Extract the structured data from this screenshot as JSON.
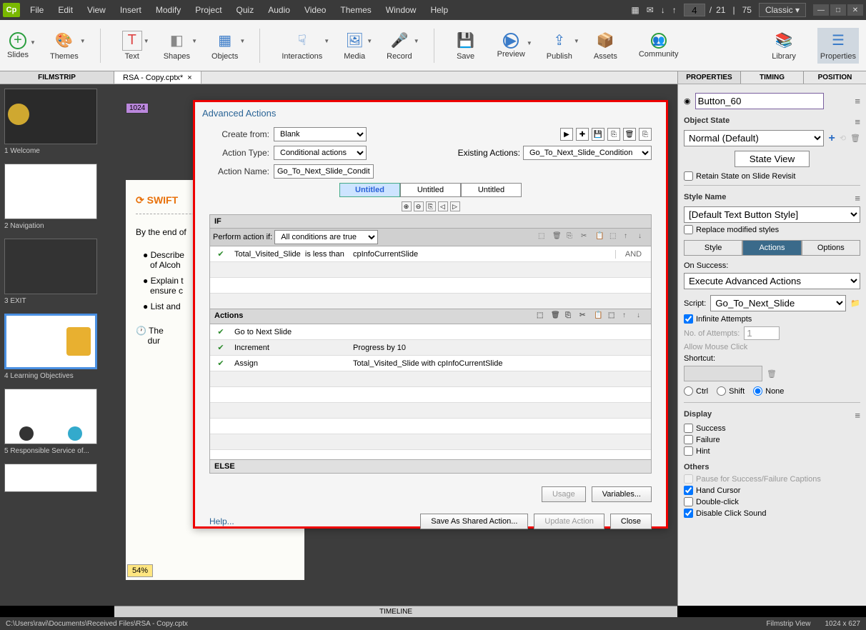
{
  "app_icon": "Cp",
  "menus": [
    "File",
    "Edit",
    "View",
    "Insert",
    "Modify",
    "Project",
    "Quiz",
    "Audio",
    "Video",
    "Themes",
    "Window",
    "Help"
  ],
  "page_current": "4",
  "page_total": "21",
  "zoom_pct": "75",
  "workspace": "Classic",
  "ribbon": {
    "slides": "Slides",
    "themes": "Themes",
    "text": "Text",
    "shapes": "Shapes",
    "objects": "Objects",
    "interactions": "Interactions",
    "media": "Media",
    "record": "Record",
    "save": "Save",
    "preview": "Preview",
    "publish": "Publish",
    "assets": "Assets",
    "community": "Community",
    "library": "Library",
    "properties": "Properties"
  },
  "filmstrip_label": "FILMSTRIP",
  "doc_tab": "RSA - Copy.cptx*",
  "prop_tabs": {
    "properties": "PROPERTIES",
    "timing": "TIMING",
    "position": "POSITION"
  },
  "thumbs": [
    {
      "label": "1 Welcome"
    },
    {
      "label": "2 Navigation"
    },
    {
      "label": "3 EXIT"
    },
    {
      "label": "4 Learning Objectives"
    },
    {
      "label": "5 Responsible Service of..."
    },
    {
      "label": ""
    }
  ],
  "ruler_value": "1024",
  "canvas_zoom": "54%",
  "timeline_label": "TIMELINE",
  "dialog": {
    "title": "Advanced Actions",
    "create_from_label": "Create from:",
    "create_from": "Blank",
    "action_type_label": "Action Type:",
    "action_type": "Conditional actions",
    "action_name_label": "Action Name:",
    "action_name": "Go_To_Next_Slide_Condition",
    "existing_label": "Existing Actions:",
    "existing": "Go_To_Next_Slide_Condition",
    "tab_label": "Untitled",
    "if_label": "IF",
    "perform_label": "Perform action if:",
    "perform_condition": "All conditions are true",
    "cond_var": "Total_Visited_Slide",
    "cond_op": "is less than",
    "cond_val": "cpInfoCurrentSlide",
    "cond_and": "AND",
    "actions_label": "Actions",
    "action_rows": [
      {
        "a": "Go to Next Slide",
        "b": ""
      },
      {
        "a": "Increment",
        "b": "Progress   by   10"
      },
      {
        "a": "Assign",
        "b": "Total_Visited_Slide   with   cpInfoCurrentSlide"
      }
    ],
    "else_label": "ELSE",
    "usage_btn": "Usage",
    "variables_btn": "Variables...",
    "help": "Help...",
    "save_shared": "Save As Shared Action...",
    "update": "Update Action",
    "close": "Close"
  },
  "props": {
    "name": "Button_60",
    "object_state": "Object State",
    "state_select": "Normal (Default)",
    "state_view": "State View",
    "retain_state": "Retain State on Slide Revisit",
    "style_name": "Style Name",
    "style_select": "[Default Text Button Style]",
    "replace_styles": "Replace modified styles",
    "tab_style": "Style",
    "tab_actions": "Actions",
    "tab_options": "Options",
    "on_success": "On Success:",
    "success_action": "Execute Advanced Actions",
    "script_label": "Script:",
    "script": "Go_To_Next_Slide",
    "infinite": "Infinite Attempts",
    "attempts_label": "No. of Attempts:",
    "attempts": "1",
    "allow_mouse": "Allow Mouse Click",
    "shortcut": "Shortcut:",
    "ctrl": "Ctrl",
    "shift": "Shift",
    "none": "None",
    "display": "Display",
    "success_chk": "Success",
    "failure_chk": "Failure",
    "hint_chk": "Hint",
    "others": "Others",
    "pause_caption": "Pause for Success/Failure Captions",
    "hand_cursor": "Hand Cursor",
    "double_click": "Double-click",
    "disable_sound": "Disable Click Sound"
  },
  "status": {
    "path": "C:\\Users\\ravi\\Documents\\Received Files\\RSA - Copy.cptx",
    "view": "Filmstrip View",
    "dims": "1024 x 627"
  }
}
